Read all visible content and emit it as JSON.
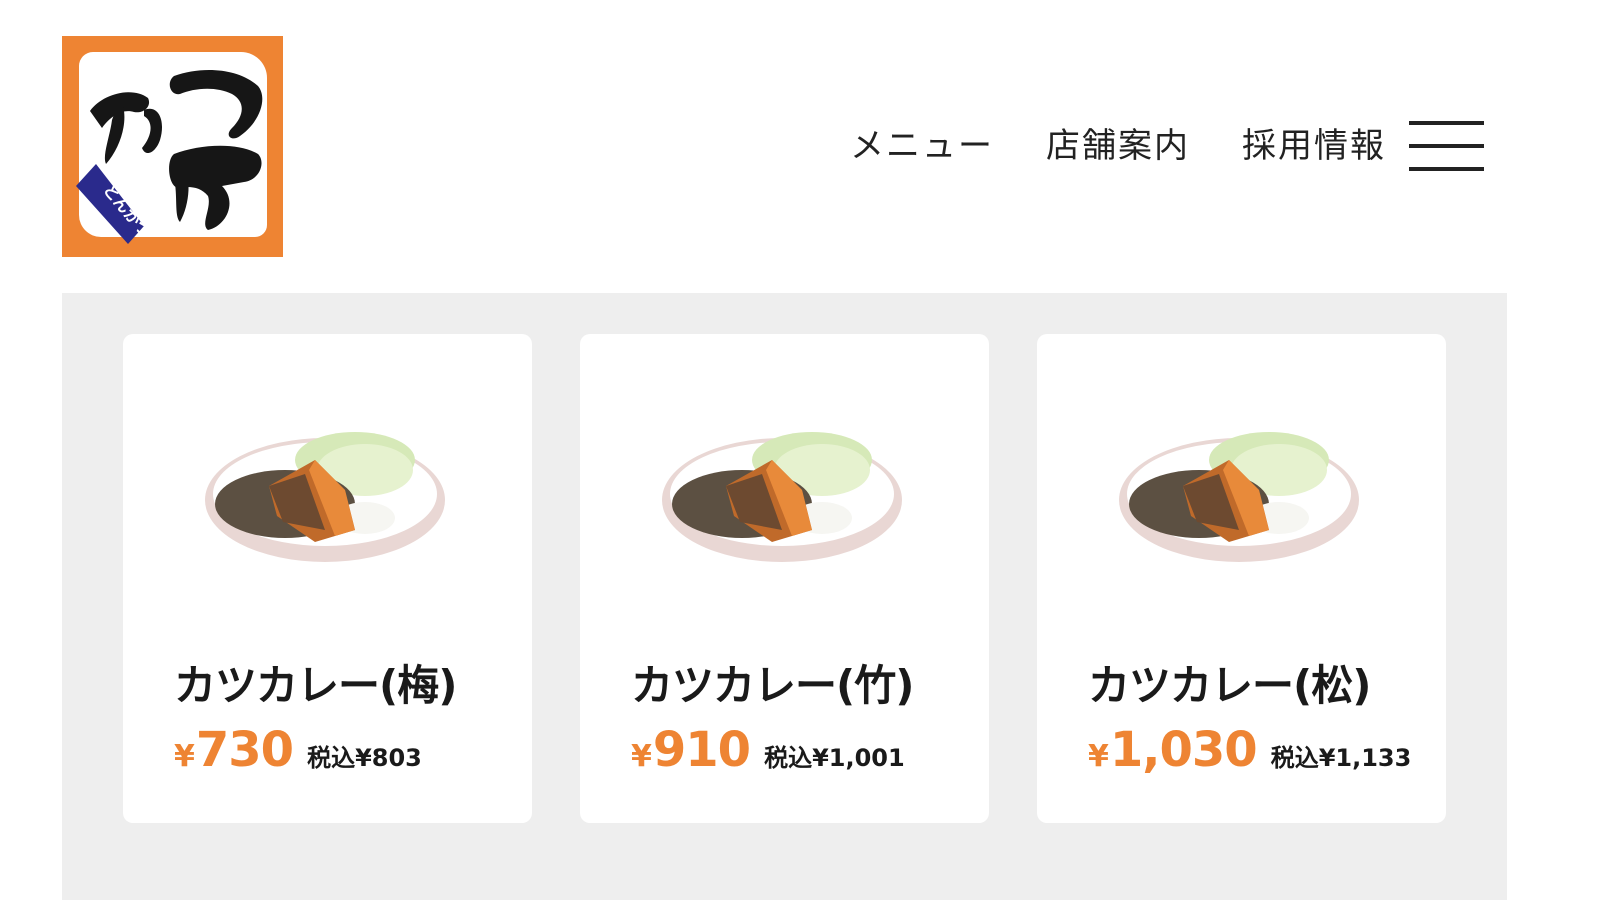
{
  "header": {
    "logo": {
      "name": "とんかつ かつや",
      "main_text": "かつや",
      "sub_text": "とんかつ",
      "color": "#ee8433"
    },
    "nav": [
      {
        "label": "メニュー"
      },
      {
        "label": "店舗案内"
      },
      {
        "label": "採用情報"
      }
    ],
    "menu_icon": "hamburger-icon"
  },
  "products": [
    {
      "name": "カツカレー(梅)",
      "currency": "¥",
      "price": "730",
      "tax_label": "税込¥803"
    },
    {
      "name": "カツカレー(竹)",
      "currency": "¥",
      "price": "910",
      "tax_label": "税込¥1,001"
    },
    {
      "name": "カツカレー(松)",
      "currency": "¥",
      "price": "1,030",
      "tax_label": "税込¥1,133"
    }
  ],
  "colors": {
    "accent": "#ee8433",
    "panel_background": "#eeeeee",
    "card_background": "#ffffff",
    "text": "#1a1a1a"
  }
}
